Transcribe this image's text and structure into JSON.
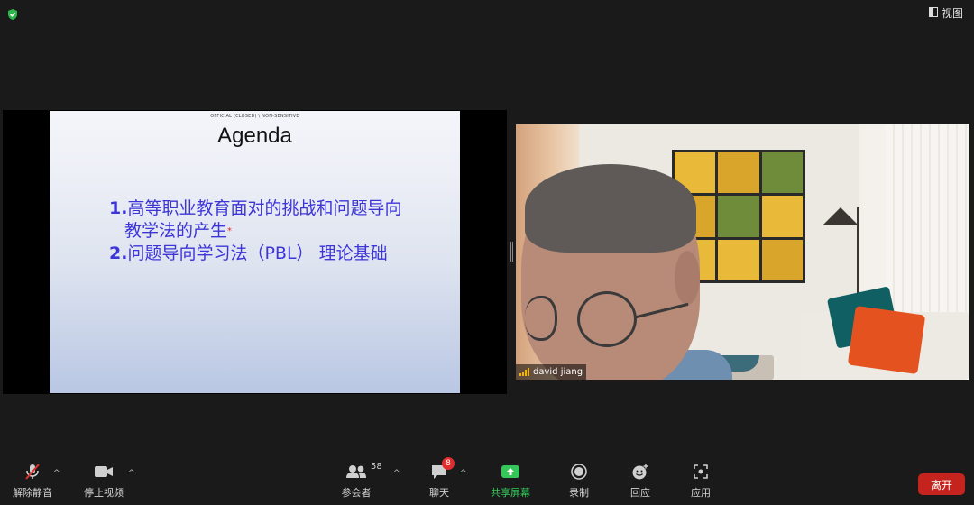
{
  "top_bar": {
    "security_icon": "shield-check-icon",
    "view_label": "视图"
  },
  "shared_slide": {
    "header_text": "OFFICIAL (CLOSED) \\ NON-SENSITIVE",
    "title": "Agenda",
    "items": [
      {
        "number": "1.",
        "line1": "高等职业教育面对的挑战和问题导向",
        "line2": "教学法的产生",
        "mark": "*"
      },
      {
        "number": "2.",
        "line1": "问题导向学习法（PBL） 理论基础"
      }
    ]
  },
  "participant_video": {
    "name": "david jiang",
    "signal_icon": "signal-bars-icon"
  },
  "toolbar": {
    "unmute_label": "解除静音",
    "stop_video_label": "停止视频",
    "participants_label": "参会者",
    "participants_count": "58",
    "chat_label": "聊天",
    "chat_badge": "8",
    "share_screen_label": "共享屏幕",
    "record_label": "录制",
    "reactions_label": "回应",
    "apps_label": "应用",
    "leave_label": "离开"
  },
  "colors": {
    "slide_text": "#3d35d8",
    "share_green": "#35c759",
    "leave_red": "#c5231d",
    "badge_red": "#e02d2d"
  }
}
